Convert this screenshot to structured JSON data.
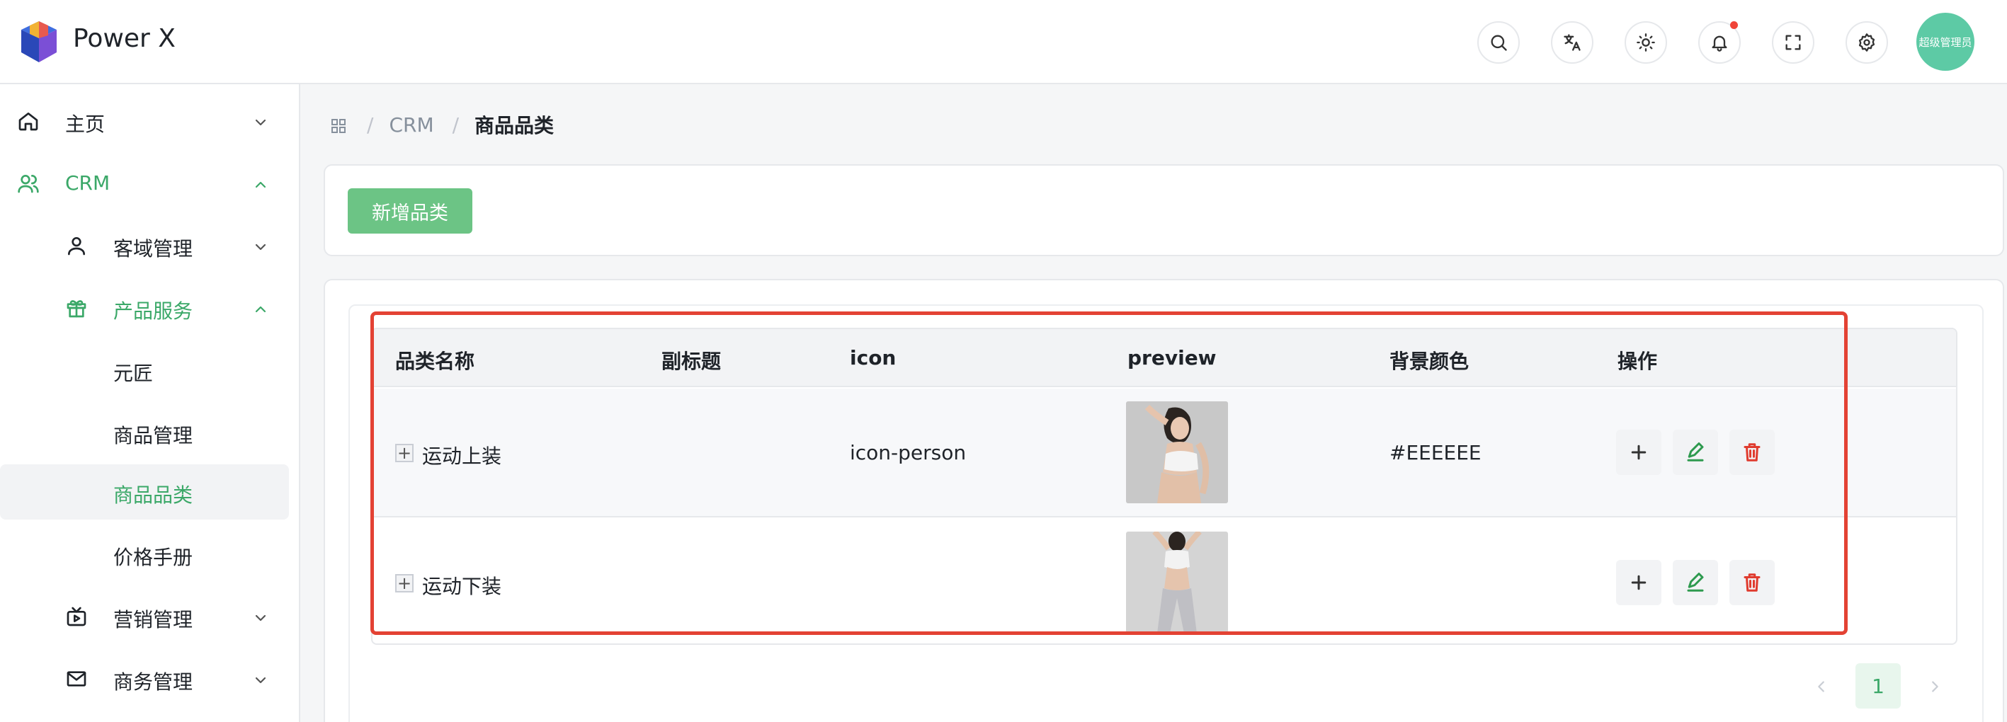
{
  "header": {
    "app_title": "Power X",
    "avatar_text": "超级管理员",
    "buttons": [
      "search-icon",
      "translate-icon",
      "theme-icon",
      "bell-icon",
      "fullscreen-icon",
      "gear-icon"
    ]
  },
  "sidebar": {
    "items": [
      {
        "label": "主页",
        "icon": "home-icon",
        "expanded": false
      },
      {
        "label": "CRM",
        "icon": "users-icon",
        "expanded": true,
        "active": true
      },
      {
        "label": "客域管理",
        "icon": "user-icon",
        "expanded": false
      },
      {
        "label": "产品服务",
        "icon": "gift-icon",
        "expanded": true,
        "active": true
      },
      {
        "label": "元匠"
      },
      {
        "label": "商品管理"
      },
      {
        "label": "商品品类",
        "selected": true
      },
      {
        "label": "价格手册"
      },
      {
        "label": "营销管理",
        "icon": "tv-icon",
        "expanded": false
      },
      {
        "label": "商务管理",
        "icon": "mail-icon",
        "expanded": false
      }
    ]
  },
  "breadcrumb": {
    "separator": "/",
    "crm": "CRM",
    "current": "商品品类"
  },
  "toolbar": {
    "add_label": "新增品类"
  },
  "table": {
    "columns": [
      "品类名称",
      "副标题",
      "icon",
      "preview",
      "背景颜色",
      "操作"
    ],
    "rows": [
      {
        "name": "运动上装",
        "subtitle": "",
        "icon": "icon-person",
        "preview": "woman-sports-top-photo",
        "bg_color": "#EEEEEE"
      },
      {
        "name": "运动下装",
        "subtitle": "",
        "icon": "",
        "preview": "woman-sports-pants-photo",
        "bg_color": ""
      }
    ],
    "expand_symbol": "+"
  },
  "pagination": {
    "current_page": "1"
  },
  "colors": {
    "brand_green": "#3ba868",
    "button_green": "#6cc485",
    "danger": "#e03b2e",
    "highlight_red": "#e34234"
  }
}
